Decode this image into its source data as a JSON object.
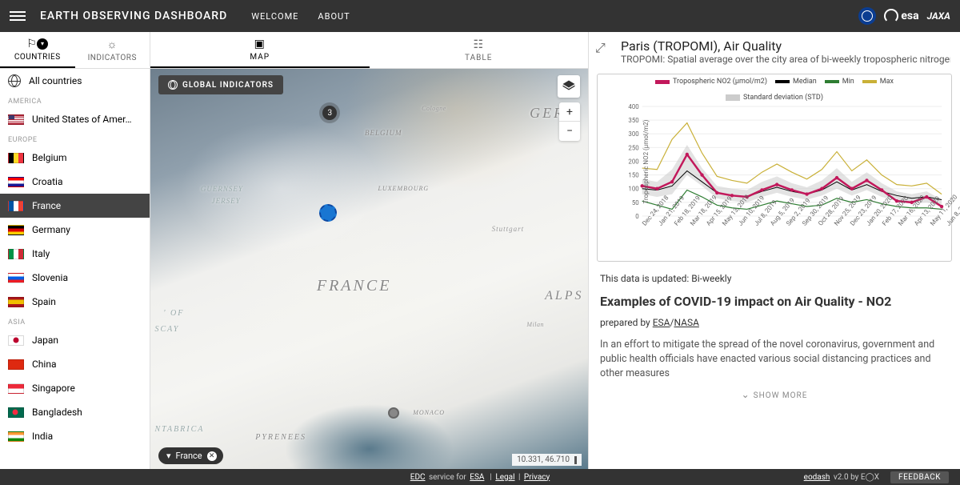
{
  "header": {
    "title": "EARTH OBSERVING DASHBOARD",
    "nav": {
      "welcome": "WELCOME",
      "about": "ABOUT"
    }
  },
  "panel_tabs": {
    "countries": "COUNTRIES",
    "indicators": "INDICATORS"
  },
  "center_tabs": {
    "map": "MAP",
    "table": "TABLE"
  },
  "countries": {
    "all": "All countries",
    "regions": {
      "america": "AMERICA",
      "europe": "EUROPE",
      "asia": "ASIA"
    },
    "america": [
      {
        "code": "us",
        "name": "United States of Amer…"
      }
    ],
    "europe": [
      {
        "code": "be",
        "name": "Belgium"
      },
      {
        "code": "hr",
        "name": "Croatia"
      },
      {
        "code": "fr",
        "name": "France"
      },
      {
        "code": "de",
        "name": "Germany"
      },
      {
        "code": "it",
        "name": "Italy"
      },
      {
        "code": "si",
        "name": "Slovenia"
      },
      {
        "code": "es",
        "name": "Spain"
      }
    ],
    "asia": [
      {
        "code": "jp",
        "name": "Japan"
      },
      {
        "code": "cn",
        "name": "China"
      },
      {
        "code": "sg",
        "name": "Singapore"
      },
      {
        "code": "bd",
        "name": "Bangladesh"
      },
      {
        "code": "in",
        "name": "India"
      }
    ]
  },
  "map": {
    "global_indicators": "GLOBAL INDICATORS",
    "cluster_count": "3",
    "filter_chip": "France",
    "coords": "10.331, 46.710",
    "labels": {
      "france": "FRANCE",
      "germ": "GERM",
      "alps": "ALPS",
      "bel": "BELGIUM",
      "lux": "LUXEMBOURG",
      "mon": "MONACO",
      "pyr": "PYRENEES",
      "gue": "GUERNSEY",
      "jer": "JERSEY",
      "scay": "SCAY",
      "of": "' OF",
      "nta": "NTABRICA",
      "stu": "Stuttgart",
      "col": "Cologne",
      "mil": "Milan"
    }
  },
  "detail": {
    "title": "Paris (TROPOMI), Air Quality",
    "subtitle": "TROPOMI: Spatial average over the city area of bi-weekly tropospheric nitrogen dio",
    "legend": {
      "main": "Tropospheric NO2 (μmol/m2)",
      "median": "Median",
      "min": "Min",
      "max": "Max",
      "std": "Standard deviation (STD)"
    },
    "yaxis_label": "Tropospheric NO2 (μmol/m2)",
    "updated": "This data is updated: Bi-weekly",
    "section_title": "Examples of COVID-19 impact on Air Quality - NO2",
    "prepared_prefix": "prepared by ",
    "prepared_esa": "ESA",
    "prepared_nasa": "NASA",
    "body": "In an effort to mitigate the spread of the novel coronavirus, government and public health officials have enacted various social distancing practices and other measures",
    "show_more": "SHOW MORE"
  },
  "chart_data": {
    "type": "line",
    "xlabel": "",
    "ylabel": "Tropospheric NO2 (μmol/m2)",
    "ylim": [
      0,
      400
    ],
    "yticks": [
      0,
      50,
      100,
      150,
      200,
      250,
      300,
      350,
      400
    ],
    "categories": [
      "Dec 24, 2018",
      "Jan 21, 2019",
      "Feb 18, 2019",
      "Mar 18, 2019",
      "Apr 15, 2019",
      "May 13, 2019",
      "Jun 10, 2019",
      "Jul 8, 2019",
      "Aug 5, 2019",
      "Sep 2, 2019",
      "Sep 30, 2019",
      "Oct 28, 2019",
      "Nov 25, 2019",
      "Dec 23, 2019",
      "Jan 20, 2020",
      "Feb 17, 2020",
      "Mar 16, 2020",
      "Apr 13, 2020",
      "May 11, 2020",
      "Jun 8, 2020"
    ],
    "series": [
      {
        "name": "Tropospheric NO2 (μmol/m2)",
        "color": "#c2185b",
        "values": [
          110,
          100,
          125,
          225,
          150,
          85,
          75,
          70,
          95,
          115,
          95,
          80,
          100,
          140,
          100,
          130,
          95,
          55,
          50,
          70,
          35
        ]
      },
      {
        "name": "Median",
        "color": "#000000",
        "values": [
          100,
          95,
          110,
          165,
          125,
          85,
          75,
          70,
          90,
          105,
          90,
          80,
          95,
          125,
          95,
          115,
          90,
          75,
          65,
          70,
          60
        ]
      },
      {
        "name": "Min",
        "color": "#2e7d32",
        "values": [
          55,
          40,
          25,
          95,
          70,
          40,
          30,
          25,
          40,
          55,
          45,
          35,
          40,
          65,
          50,
          60,
          45,
          35,
          30,
          30,
          25
        ]
      },
      {
        "name": "Max",
        "color": "#c9b037",
        "values": [
          175,
          170,
          280,
          340,
          230,
          145,
          130,
          120,
          160,
          190,
          160,
          135,
          170,
          235,
          165,
          205,
          150,
          115,
          110,
          120,
          80
        ]
      }
    ],
    "std_band": {
      "upper": [
        135,
        125,
        170,
        260,
        175,
        110,
        100,
        95,
        125,
        145,
        120,
        105,
        130,
        175,
        125,
        160,
        120,
        90,
        80,
        90,
        60
      ],
      "lower": [
        80,
        70,
        80,
        150,
        110,
        65,
        55,
        50,
        70,
        85,
        70,
        60,
        75,
        100,
        75,
        95,
        70,
        55,
        45,
        50,
        35
      ]
    }
  },
  "footer": {
    "edc_prefix": "EDC",
    "edc_text": " service for ",
    "esa": "ESA",
    "legal": "Legal",
    "privacy": "Privacy",
    "eodash": "eodash",
    "version": " v2.0 by ",
    "eox": "E◯X",
    "feedback": "FEEDBACK"
  }
}
